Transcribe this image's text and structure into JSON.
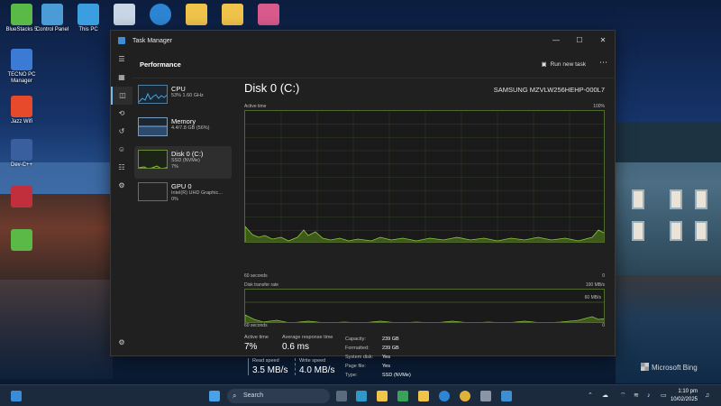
{
  "desktop": {
    "icons": [
      {
        "label": "BlueStacks 5",
        "color": "#5bb947"
      },
      {
        "label": "Control Panel",
        "color": "#4a9bd6"
      },
      {
        "label": "This PC",
        "color": "#3a9ee0"
      },
      {
        "label": "",
        "color": "#c9d7e6"
      },
      {
        "label": "",
        "color": "#2d86d4"
      },
      {
        "label": "",
        "color": "#f0c44a"
      },
      {
        "label": "",
        "color": "#f0c44a"
      },
      {
        "label": "",
        "color": "#d95a8d"
      },
      {
        "label": "TECNO PC Manager",
        "color": "#3b7bd6"
      },
      {
        "label": "Jazz Wifi",
        "color": "#e64a2a"
      },
      {
        "label": "Dev-C++",
        "color": "#3a5f9e"
      },
      {
        "label": "",
        "color": "#c22f3c"
      },
      {
        "label": "",
        "color": "#5bb947"
      }
    ],
    "watermark": "Microsoft Bing"
  },
  "taskmanager": {
    "title": "Task Manager",
    "window_controls": [
      "—",
      "☐",
      "✕"
    ],
    "page_title": "Performance",
    "run_new_task": "Run new task",
    "more": "⋯",
    "rail_icons": [
      "☰",
      "▦",
      "◫",
      "⟲",
      "↺",
      "☺",
      "☷",
      "⚙",
      "⚙"
    ],
    "items": [
      {
        "name": "CPU",
        "sub1": "53% 1.60 GHz",
        "sub2": ""
      },
      {
        "name": "Memory",
        "sub1": "4.4/7.8 GB (56%)",
        "sub2": ""
      },
      {
        "name": "Disk 0 (C:)",
        "sub1": "SSD (NVMe)",
        "sub2": "7%"
      },
      {
        "name": "GPU 0",
        "sub1": "Intel(R) UHD Graphic...",
        "sub2": "0%"
      }
    ],
    "disk_title": "Disk 0 (C:)",
    "disk_model": "SAMSUNG MZVLW256HEHP-000L7",
    "graph1": {
      "label": "Active time",
      "max": "100%",
      "xleft": "60 seconds",
      "xright": "0"
    },
    "graph2": {
      "label": "Disk transfer rate",
      "max": "100 MB/s",
      "mid": "60 MB/s",
      "xleft": "60 seconds",
      "xright": "0"
    },
    "stats": {
      "active_time_label": "Active time",
      "active_time": "7%",
      "avg_resp_label": "Average response time",
      "avg_resp": "0.6 ms",
      "read_label": "Read speed",
      "read": "3.5 MB/s",
      "write_label": "Write speed",
      "write": "4.0 MB/s"
    },
    "props": [
      {
        "k": "Capacity:",
        "v": "239 GB"
      },
      {
        "k": "Formatted:",
        "v": "239 GB"
      },
      {
        "k": "System disk:",
        "v": "Yes"
      },
      {
        "k": "Page file:",
        "v": "Yes"
      },
      {
        "k": "Type:",
        "v": "SSD (NVMe)"
      }
    ]
  },
  "taskbar": {
    "search_placeholder": "Search",
    "clock_time": "1:10 pm",
    "clock_date": "10/02/2025"
  }
}
